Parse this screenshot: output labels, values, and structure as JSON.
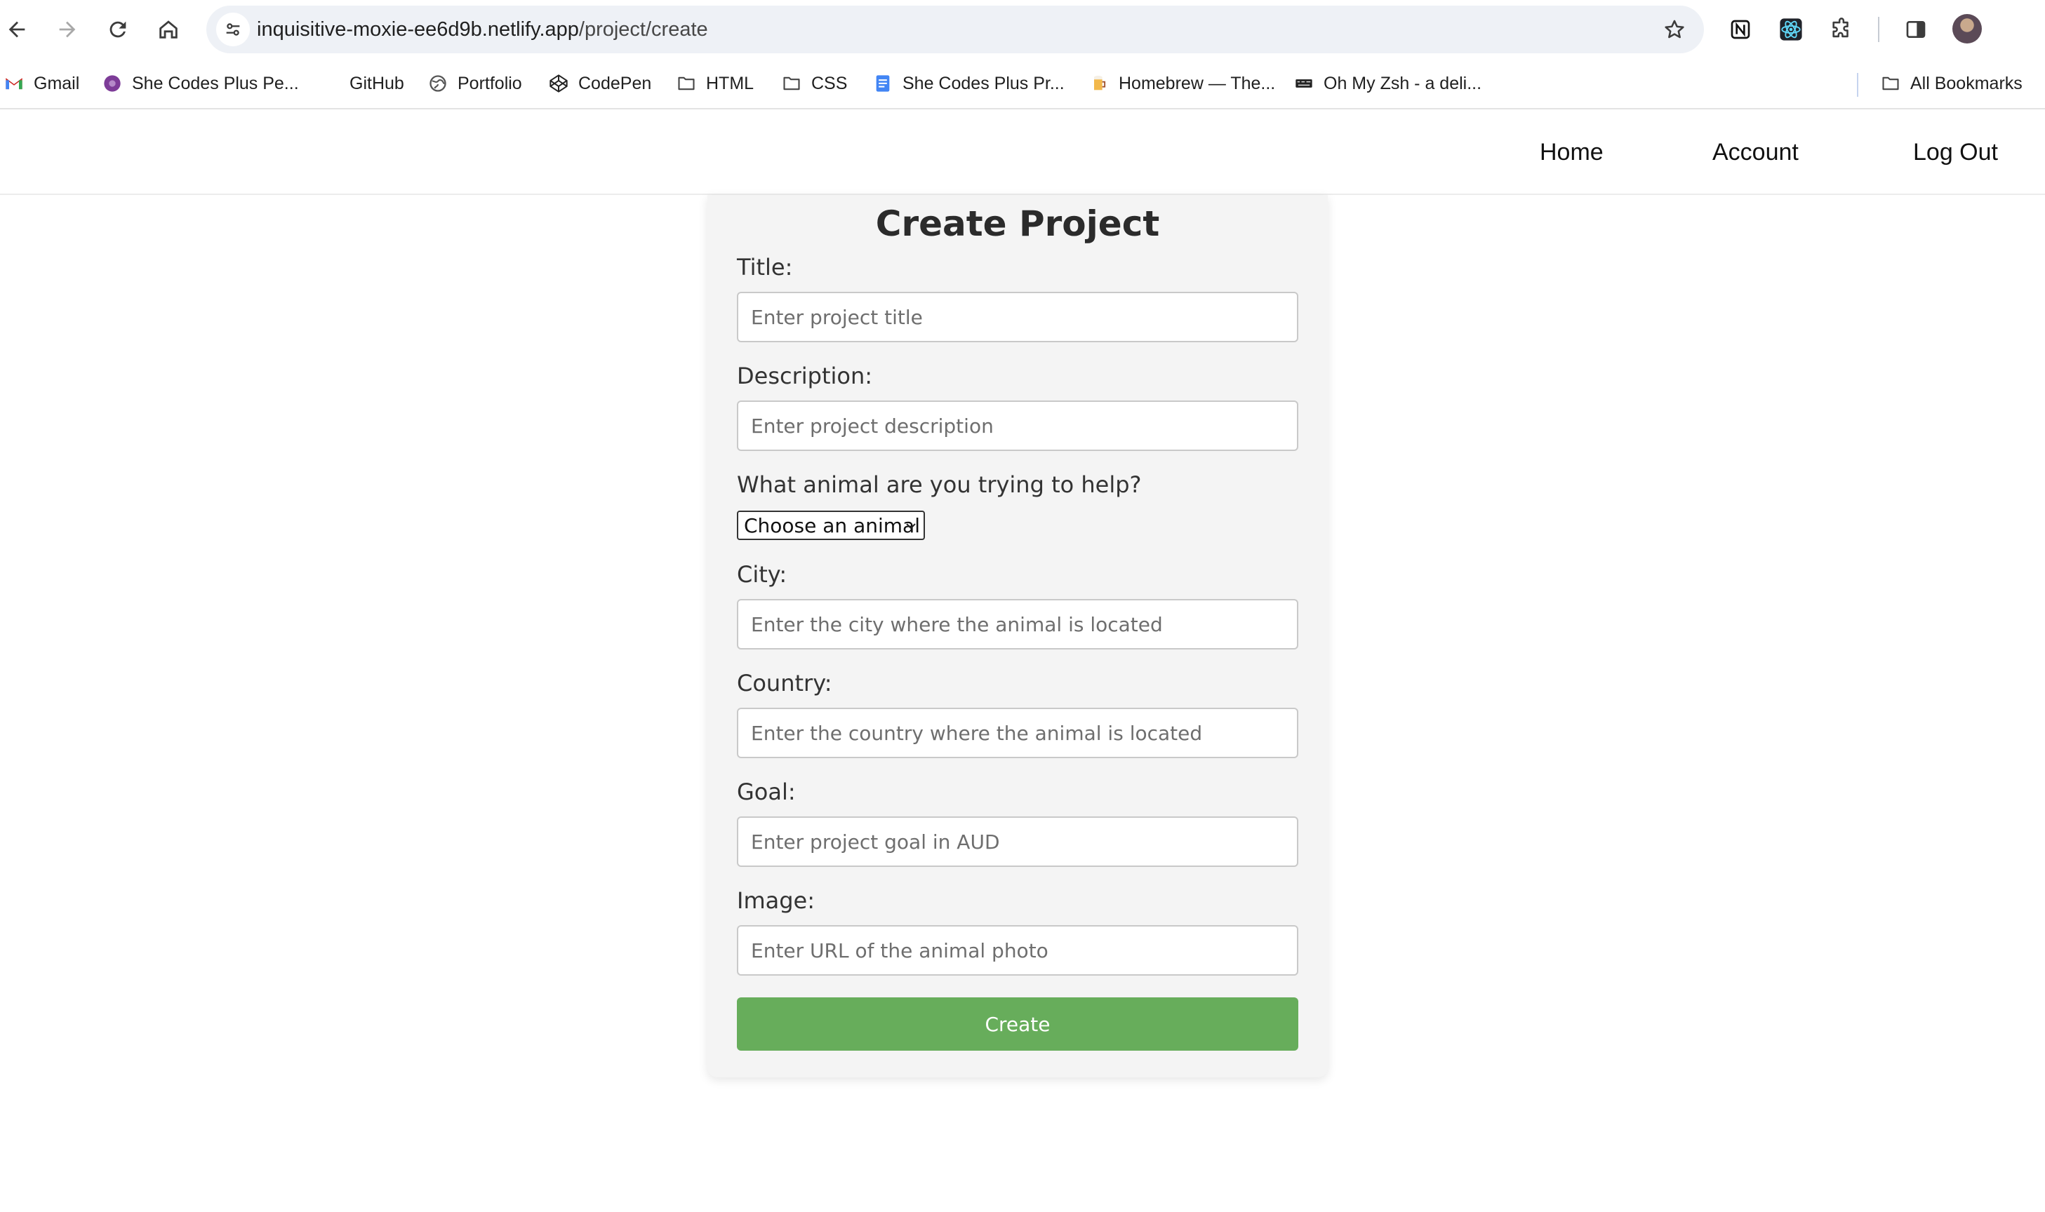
{
  "browser": {
    "url_host": "inquisitive-moxie-ee6d9b.netlify.app",
    "url_path": "/project/create",
    "bookmarks": [
      {
        "label": "Gmail",
        "icon": "gmail-icon"
      },
      {
        "label": "She Codes Plus Pe...",
        "icon": "she-codes-icon"
      },
      {
        "label": "GitHub",
        "icon": "github-icon"
      },
      {
        "label": "Portfolio",
        "icon": "globe-icon"
      },
      {
        "label": "CodePen",
        "icon": "codepen-icon"
      },
      {
        "label": "HTML",
        "icon": "folder-icon"
      },
      {
        "label": "CSS",
        "icon": "folder-icon"
      },
      {
        "label": "She Codes Plus Pr...",
        "icon": "docs-icon"
      },
      {
        "label": "Homebrew — The...",
        "icon": "homebrew-icon"
      },
      {
        "label": "Oh My Zsh - a deli...",
        "icon": "ohmyzsh-icon"
      }
    ],
    "all_bookmarks_label": "All Bookmarks"
  },
  "site_nav": {
    "home": "Home",
    "account": "Account",
    "logout": "Log Out"
  },
  "form": {
    "title": "Create Project",
    "fields": {
      "title": {
        "label": "Title:",
        "placeholder": "Enter project title"
      },
      "description": {
        "label": "Description:",
        "placeholder": "Enter project description"
      },
      "animal": {
        "label": "What animal are you trying to help?",
        "selected": "Choose an animal"
      },
      "city": {
        "label": "City:",
        "placeholder": "Enter the city where the animal is located"
      },
      "country": {
        "label": "Country:",
        "placeholder": "Enter the country where the animal is located"
      },
      "goal": {
        "label": "Goal:",
        "placeholder": "Enter project goal in AUD"
      },
      "image": {
        "label": "Image:",
        "placeholder": "Enter URL of the animal photo"
      }
    },
    "submit_label": "Create"
  },
  "colors": {
    "button_green": "#67ad5b",
    "card_bg": "#f4f4f4",
    "omnibox_bg": "#eef1f6"
  }
}
